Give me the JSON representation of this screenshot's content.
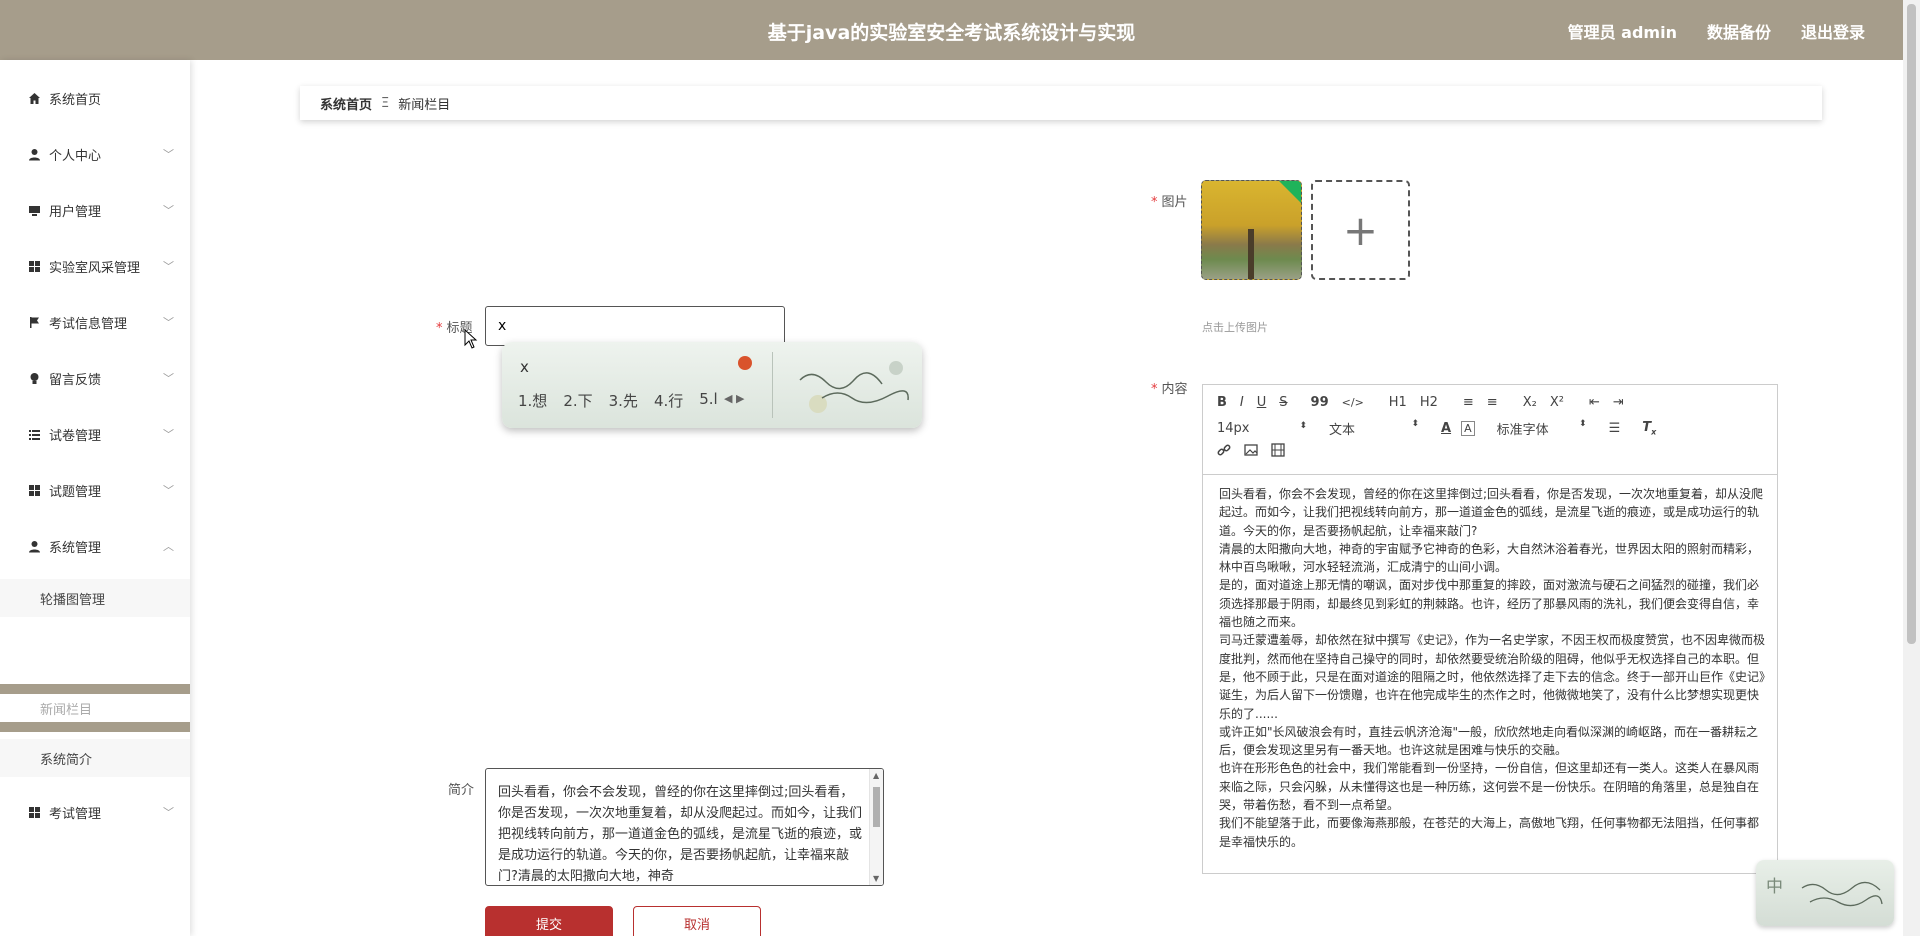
{
  "header": {
    "title": "基于java的实验室安全考试系统设计与实现",
    "links": [
      "管理员 admin",
      "数据备份",
      "退出登录"
    ]
  },
  "sidebar": {
    "items": [
      {
        "label": "系统首页",
        "icon": "home-icon"
      },
      {
        "label": "个人中心",
        "icon": "user-icon"
      },
      {
        "label": "用户管理",
        "icon": "monitor-icon"
      },
      {
        "label": "实验室风采管理",
        "icon": "grid-icon"
      },
      {
        "label": "考试信息管理",
        "icon": "flag-icon"
      },
      {
        "label": "留言反馈",
        "icon": "bulb-icon"
      },
      {
        "label": "试卷管理",
        "icon": "list-icon"
      },
      {
        "label": "试题管理",
        "icon": "grid-icon"
      },
      {
        "label": "系统管理",
        "icon": "user-icon"
      },
      {
        "label": "考试管理",
        "icon": "grid-icon"
      }
    ],
    "sub_items": [
      "轮播图管理",
      "新闻栏目",
      "系统简介"
    ]
  },
  "breadcrumb": {
    "home": "系统首页",
    "separator": "Ξ",
    "current": "新闻栏目"
  },
  "form": {
    "title_label": "标题",
    "title_value": "x",
    "intro_label": "简介",
    "intro_text": "回头看看，你会不会发现，曾经的你在这里摔倒过;回头看看，你是否发现，一次次地重复着，却从没爬起过。而如今，让我们把视线转向前方，那一道道金色的弧线，是流星飞逝的痕迹，或是成功运行的轨道。今天的你，是否要扬帆起航，让幸福来敲门?清晨的太阳撒向大地，神奇",
    "image_label": "图片",
    "upload_hint": "点击上传图片",
    "content_label": "内容",
    "submit_label": "提交",
    "cancel_label": "取消"
  },
  "ime": {
    "typed": "x",
    "candidates": [
      "1.想",
      "2.下",
      "3.先",
      "4.行",
      "5.l"
    ],
    "float_char": "中"
  },
  "editor": {
    "toolbar": {
      "row1": [
        "B",
        "I",
        "U",
        "S",
        "99",
        "</>",
        "H1",
        "H2",
        "≡",
        "≡",
        "X₂",
        "X²",
        "⇤",
        "⇥"
      ],
      "font_size": "14px",
      "header": "文本",
      "font_family": "标准字体"
    },
    "paragraphs": [
      "回头看看，你会不会发现，曾经的你在这里摔倒过;回头看看，你是否发现，一次次地重复着，却从没爬起过。而如今，让我们把视线转向前方，那一道道金色的弧线，是流星飞逝的痕迹，或是成功运行的轨道。今天的你，是否要扬帆起航，让幸福来敲门?",
      "清晨的太阳撒向大地，神奇的宇宙赋予它神奇的色彩，大自然沐浴着春光，世界因太阳的照射而精彩，林中百鸟啾啾，河水轻轻流淌，汇成清宁的山间小调。",
      "是的，面对道途上那无情的嘲讽，面对步伐中那重复的摔跤，面对激流与硬石之间猛烈的碰撞，我们必须选择那最于阴雨，却最终见到彩虹的荆棘路。也许，经历了那暴风雨的洗礼，我们便会变得自信，幸福也随之而来。",
      "司马迁蒙遭羞辱，却依然在狱中撰写《史记》，作为一名史学家，不因王权而极度赞赏，也不因卑微而极度批判，然而他在坚持自己操守的同时，却依然要受统治阶级的阻碍，他似乎无权选择自己的本职。但是，他不顾于此，只是在面对道途的阻隔之时，他依然选择了走下去的信念。终于一部开山巨作《史记》诞生，为后人留下一份馈赠，也许在他完成毕生的杰作之时，他微微地笑了，没有什么比梦想实现更快乐的了......",
      "或许正如\"长风破浪会有时，直挂云帆济沧海\"一般，欣欣然地走向看似深渊的崎岖路，而在一番耕耘之后，便会发现这里另有一番天地。也许这就是困难与快乐的交融。",
      "也许在形形色色的社会中，我们常能看到一份坚持，一份自信，但这里却还有一类人。这类人在暴风雨来临之际，只会闪躲，从未懂得这也是一种历练，这何尝不是一份快乐。在阴暗的角落里，总是独自在哭，带着伤愁，看不到一点希望。",
      "我们不能望落于此，而要像海燕那般，在苍茫的大海上，高傲地飞翔，任何事物都无法阻挡，任何事都是幸福快乐的。"
    ]
  }
}
